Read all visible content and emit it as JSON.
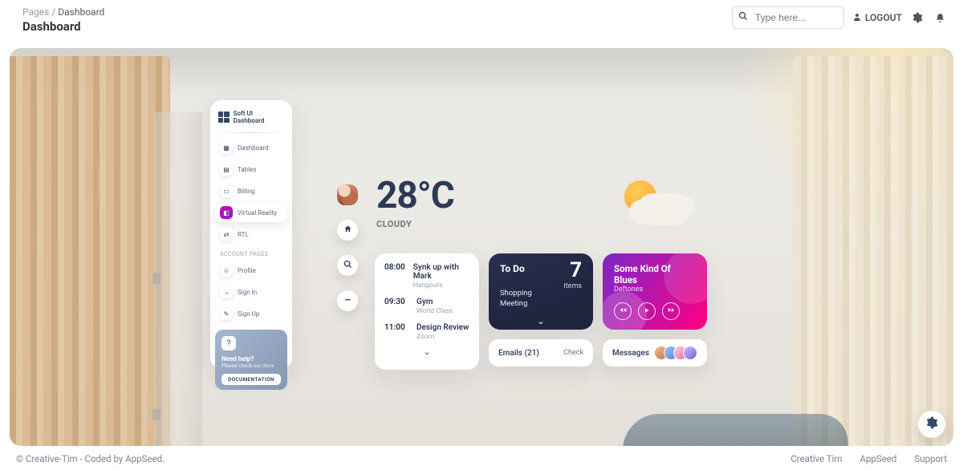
{
  "breadcrumb": {
    "root": "Pages",
    "sep": "/",
    "current": "Dashboard"
  },
  "page_title": "Dashboard",
  "search": {
    "placeholder": "Type here..."
  },
  "user": {
    "logout": "LOGOUT"
  },
  "sidebar": {
    "brand": "Soft UI Dashboard",
    "items": [
      {
        "label": "Dashboard",
        "icon": "dashboard-icon"
      },
      {
        "label": "Tables",
        "icon": "tables-icon"
      },
      {
        "label": "Billing",
        "icon": "billing-icon"
      },
      {
        "label": "Virtual Reality",
        "icon": "vr-icon",
        "active": true
      },
      {
        "label": "RTL",
        "icon": "rtl-icon"
      }
    ],
    "section_label": "ACCOUNT PAGES",
    "account": [
      {
        "label": "Profile",
        "icon": "profile-icon"
      },
      {
        "label": "Sign In",
        "icon": "signin-icon"
      },
      {
        "label": "Sign Up",
        "icon": "signup-icon"
      }
    ],
    "help": {
      "title": "Need help?",
      "subtitle": "Please check our docs",
      "button": "DOCUMENTATION"
    }
  },
  "sidebuttons": {
    "home": "home-icon",
    "search": "search-icon",
    "minimize": "minus-icon"
  },
  "weather": {
    "temperature": "28°C",
    "condition": "CLOUDY"
  },
  "schedule": [
    {
      "time": "08:00",
      "title": "Synk up with Mark",
      "sub": "Hangouts"
    },
    {
      "time": "09:30",
      "title": "Gym",
      "sub": "World Class"
    },
    {
      "time": "11:00",
      "title": "Design Review",
      "sub": "Zoom"
    }
  ],
  "todo": {
    "title": "To Do",
    "count": "7",
    "unit": "items",
    "items": [
      "Shopping",
      "Meeting"
    ]
  },
  "music": {
    "title": "Some Kind Of Blues",
    "artist": "Deftones"
  },
  "emails": {
    "label": "Emails (21)",
    "action": "Check"
  },
  "messages": {
    "label": "Messages"
  },
  "footer": {
    "left": "© Creative-Tim - Coded by AppSeed.",
    "links": [
      "Creative Tim",
      "AppSeed",
      "Support"
    ]
  }
}
